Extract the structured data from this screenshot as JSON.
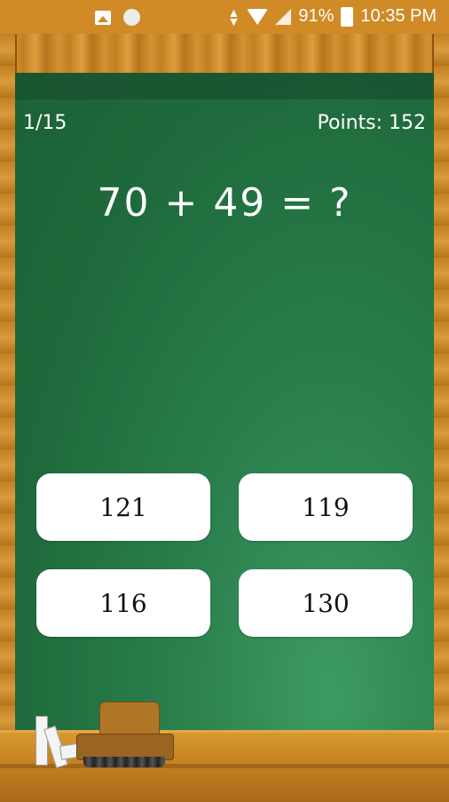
{
  "status_bar": {
    "battery": "91%",
    "time": "10:35 PM",
    "icons": [
      "image-icon",
      "circle-icon",
      "data-arrows-icon",
      "wifi-icon",
      "signal-icon",
      "battery-icon"
    ]
  },
  "game": {
    "progress": "1/15",
    "points": "Points: 152",
    "question": "70 + 49 = ?",
    "answers": [
      "121",
      "119",
      "116",
      "130"
    ]
  },
  "colors": {
    "board_green": "#1f6a3c",
    "frame_wood": "#c98a2c",
    "answer_bg": "#ffffff"
  }
}
